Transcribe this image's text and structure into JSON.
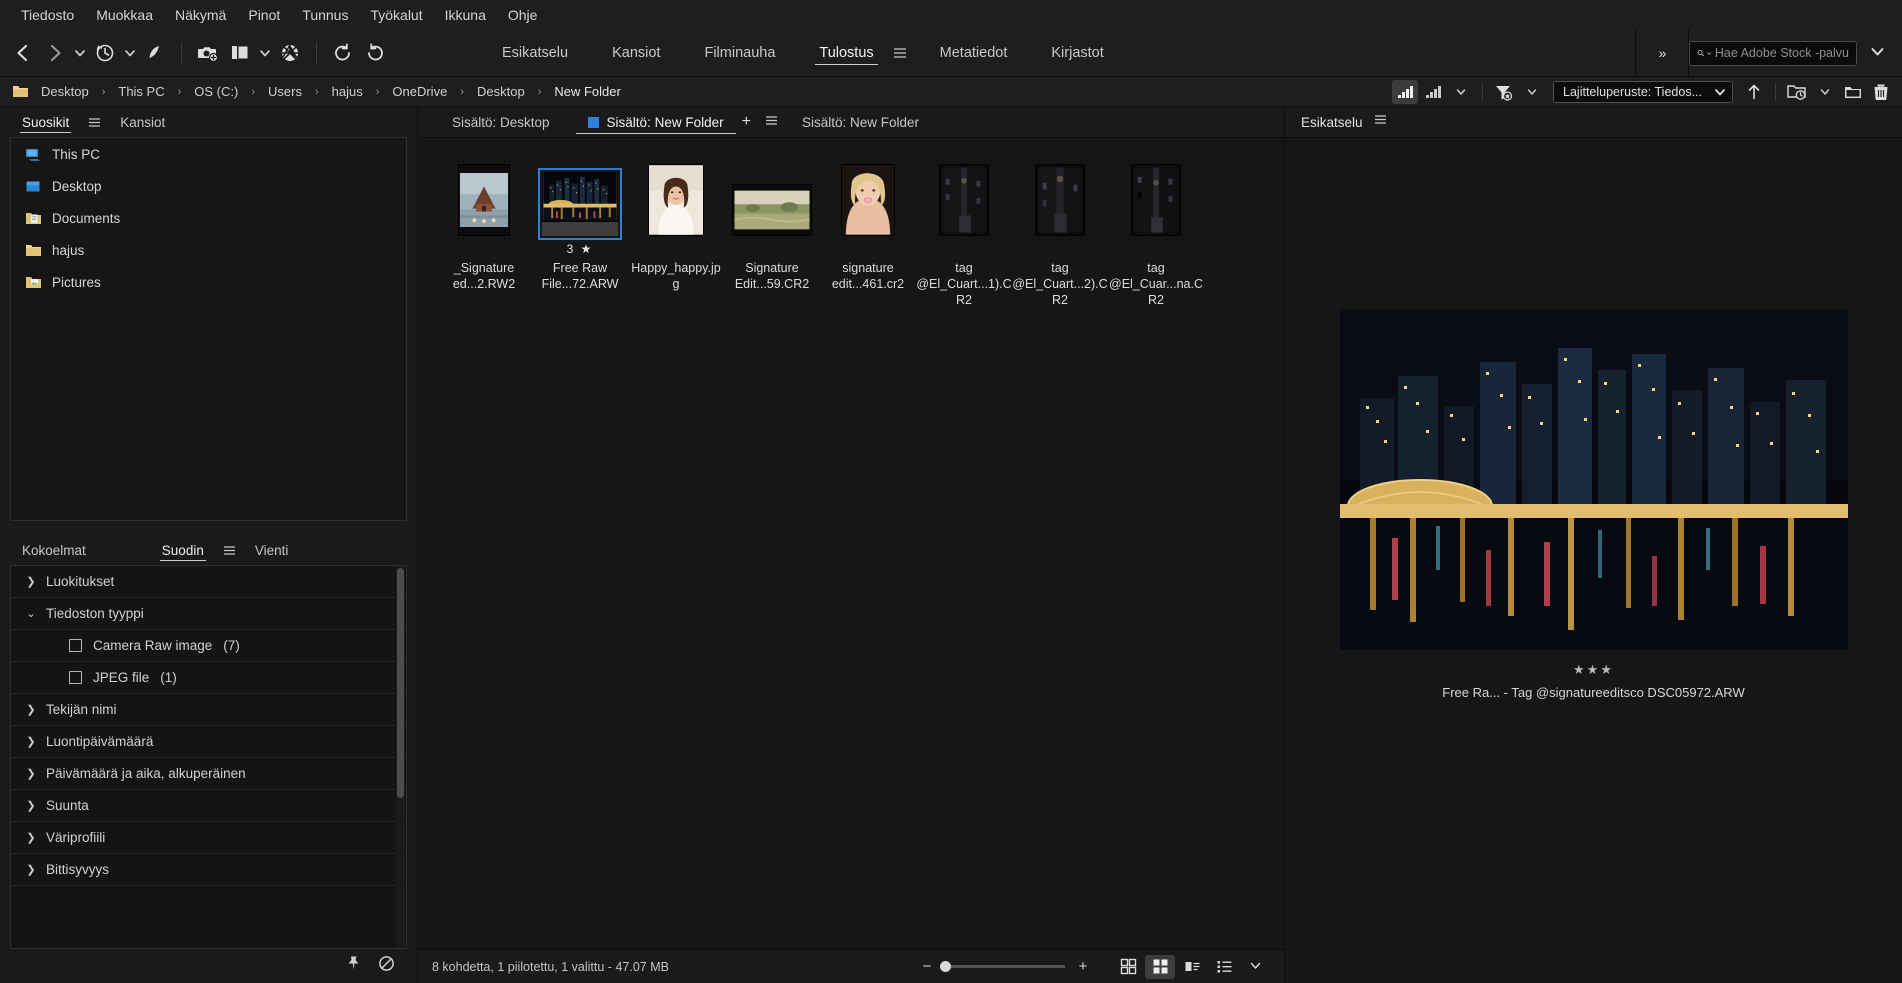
{
  "menu": {
    "items": [
      "Tiedosto",
      "Muokkaa",
      "Näkymä",
      "Pinot",
      "Tunnus",
      "Työkalut",
      "Ikkuna",
      "Ohje"
    ]
  },
  "toolbar": {
    "icons": [
      "back-arrow",
      "forward-arrow",
      "chevron-down",
      "history-clock",
      "chevron-down",
      "boomerang",
      "get-photos-camera",
      "stack-copy",
      "chevron-down",
      "aperture",
      "rotate-ccw",
      "rotate-cw"
    ],
    "workspaces": [
      {
        "label": "Esikatselu",
        "active": false
      },
      {
        "label": "Kansiot",
        "active": false
      },
      {
        "label": "Filminauha",
        "active": false
      },
      {
        "label": "Tulostus",
        "active": true
      },
      {
        "label": "Metatiedot",
        "active": false
      },
      {
        "label": "Kirjastot",
        "active": false
      }
    ],
    "overflow": "»",
    "stock_search_placeholder": "Hae Adobe Stock -palvu",
    "stock_search_value": ""
  },
  "pathbar": {
    "crumbs": [
      "Desktop",
      "This PC",
      "OS (C:)",
      "Users",
      "hajus",
      "OneDrive",
      "Desktop",
      "New Folder"
    ],
    "separator": "›",
    "sort_label": "Lajitteluperuste: Tiedos...",
    "icons": [
      "filter-rating-high",
      "filter-rating-menu",
      "filter-funnel",
      "sort-ascending",
      "recent-folder",
      "new-folder",
      "delete-trash"
    ]
  },
  "favorites": {
    "tabs": [
      {
        "label": "Suosikit",
        "active": true
      },
      {
        "label": "Kansiot",
        "active": false
      }
    ],
    "items": [
      {
        "label": "This PC",
        "icon": "pc-icon"
      },
      {
        "label": "Desktop",
        "icon": "desktop-icon"
      },
      {
        "label": "Documents",
        "icon": "documents-folder-icon"
      },
      {
        "label": "hajus",
        "icon": "folder-icon"
      },
      {
        "label": "Pictures",
        "icon": "pictures-folder-icon"
      }
    ]
  },
  "filterpanel": {
    "tabs": [
      {
        "label": "Kokoelmat",
        "active": false
      },
      {
        "label": "Suodin",
        "active": true
      },
      {
        "label": "Vienti",
        "active": false
      }
    ],
    "rows": [
      {
        "label": "Luokitukset",
        "expanded": false
      },
      {
        "label": "Tiedoston tyyppi",
        "expanded": true
      },
      {
        "label": "Tekijän nimi",
        "expanded": false
      },
      {
        "label": "Luontipäivämäärä",
        "expanded": false
      },
      {
        "label": "Päivämäärä ja aika, alkuperäinen",
        "expanded": false
      },
      {
        "label": "Suunta",
        "expanded": false
      },
      {
        "label": "Väriprofiili",
        "expanded": false
      },
      {
        "label": "Bittisyvyys",
        "expanded": false
      }
    ],
    "filetypes": [
      {
        "label": "Camera Raw image",
        "count": "(7)",
        "checked": false
      },
      {
        "label": "JPEG file",
        "count": "(1)",
        "checked": false
      }
    ],
    "footer_icons": [
      "pin-icon",
      "clear-filter-icon"
    ]
  },
  "content": {
    "tabs": [
      {
        "label": "Sisältö: Desktop",
        "active": false,
        "marker": false
      },
      {
        "label": "Sisältö: New Folder",
        "active": true,
        "marker": true
      },
      {
        "label": "Sisältö: New Folder",
        "active": false,
        "marker": false
      }
    ],
    "add_tab": "+",
    "items": [
      {
        "name": "_Signature ed...2.RW2",
        "rating": "",
        "selected": false,
        "thumb": "boat-house-lake"
      },
      {
        "name": "Free Raw File...72.ARW",
        "rating": "3 ★",
        "selected": true,
        "thumb": "city-night-skyline"
      },
      {
        "name": "Happy_happy.jpg",
        "rating": "",
        "selected": false,
        "thumb": "woman-portrait-white"
      },
      {
        "name": "Signature Edit...59.CR2",
        "rating": "",
        "selected": false,
        "thumb": "field-landscape"
      },
      {
        "name": "signature edit...461.cr2",
        "rating": "",
        "selected": false,
        "thumb": "blonde-woman-portrait"
      },
      {
        "name": "tag @El_Cuart...1).CR2",
        "rating": "",
        "selected": false,
        "thumb": "dark-alley-1"
      },
      {
        "name": "tag @El_Cuart...2).CR2",
        "rating": "",
        "selected": false,
        "thumb": "dark-alley-2"
      },
      {
        "name": "tag @El_Cuar...na.CR2",
        "rating": "",
        "selected": false,
        "thumb": "dark-alley-3"
      }
    ]
  },
  "statusbar": {
    "text": "8 kohdetta, 1 piilotettu, 1 valittu - 47.07 MB",
    "zoom_minus": "−",
    "zoom_plus": "+",
    "views": [
      "grid-view",
      "thumbnail-view",
      "details-view",
      "list-view"
    ],
    "view_chevron": "⌄"
  },
  "preview": {
    "title": "Esikatselu",
    "stars": "★★★",
    "caption": "Free Ra... - Tag @signatureeditsco DSC05972.ARW"
  },
  "colors": {
    "accent_blue": "#2d7fe0",
    "panel_bg": "#1a1a1a",
    "content_bg": "#161616",
    "text": "#d2d2d2"
  }
}
